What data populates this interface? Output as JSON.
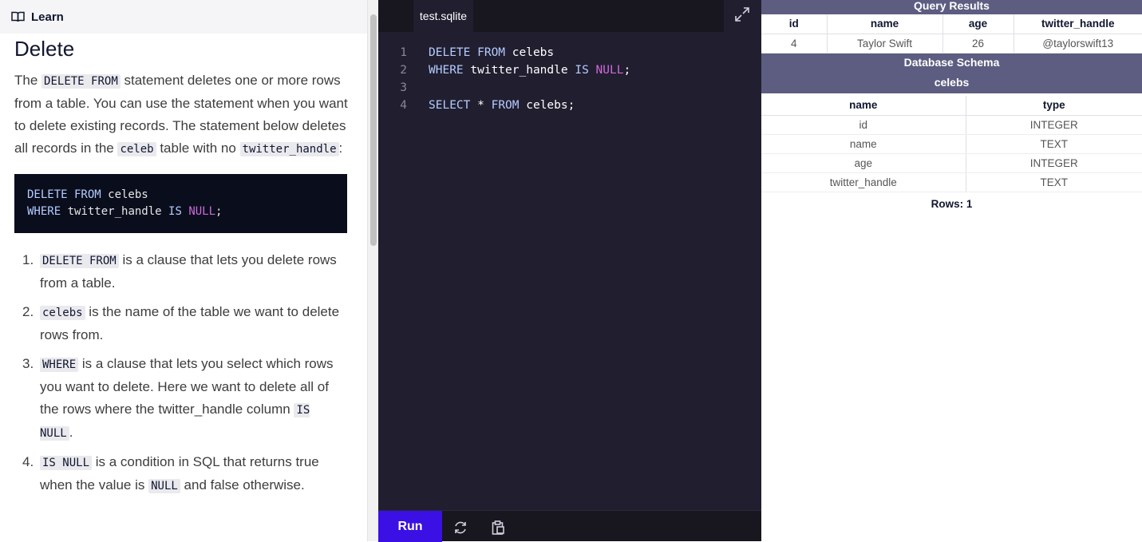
{
  "learn": {
    "header_title": "Learn",
    "heading": "Delete",
    "intro": {
      "t1": "The ",
      "c1": "DELETE FROM",
      "t2": " statement deletes one or more rows from a table. You can use the statement when you want to delete existing records. The statement below deletes all records in the ",
      "c2": "celeb",
      "t3": " table with no ",
      "c3": "twitter_handle",
      "t4": ":"
    },
    "code_block": {
      "l1_kw": "DELETE FROM",
      "l1_rest": " celebs",
      "l2_kw": "WHERE",
      "l2_mid": " twitter_handle ",
      "l2_kw2": "IS",
      "l2_sp": " ",
      "l2_null": "NULL",
      "l2_end": ";"
    },
    "steps": [
      {
        "num": "1.",
        "c1": "DELETE FROM",
        "t1": " is a clause that lets you delete rows from a table."
      },
      {
        "num": "2.",
        "c1": "celebs",
        "t1": " is the name of the table we want to delete rows from."
      },
      {
        "num": "3.",
        "c1": "WHERE",
        "t1": " is a clause that lets you select which rows you want to delete. Here we want to delete all of the rows where the twitter_handle column ",
        "c2": "IS NULL",
        "t2": "."
      },
      {
        "num": "4.",
        "c1": "IS NULL",
        "t1": " is a condition in SQL that returns true when the value is ",
        "c2": "NULL",
        "t2": " and false otherwise."
      }
    ]
  },
  "editor": {
    "tab_name": "test.sqlite",
    "lines": [
      {
        "n": "1",
        "kw1": "DELETE FROM",
        "rest": " celebs"
      },
      {
        "n": "2",
        "kw1": "WHERE",
        "mid": " twitter_handle ",
        "kw2": "IS",
        "sp": " ",
        "null": "NULL",
        "end": ";"
      },
      {
        "n": "3"
      },
      {
        "n": "4",
        "kw1": "SELECT",
        "mid": " * ",
        "kw2": "FROM",
        "rest": " celebs;"
      }
    ],
    "run_label": "Run"
  },
  "results": {
    "query_title": "Query Results",
    "columns": [
      "id",
      "name",
      "age",
      "twitter_handle"
    ],
    "rows": [
      [
        "4",
        "Taylor Swift",
        "26",
        "@taylorswift13"
      ]
    ],
    "schema_title": "Database Schema",
    "table_name": "celebs",
    "schema_columns": [
      "name",
      "type"
    ],
    "schema_rows": [
      [
        "id",
        "INTEGER"
      ],
      [
        "name",
        "TEXT"
      ],
      [
        "age",
        "INTEGER"
      ],
      [
        "twitter_handle",
        "TEXT"
      ]
    ],
    "rows_count": "Rows: 1"
  },
  "colors": {
    "run_button": "#3a10e5",
    "editor_bg": "#211e2f",
    "results_banner": "#5d5d82",
    "keyword": "#b3ccff",
    "null_keyword": "#cc6bd9"
  }
}
